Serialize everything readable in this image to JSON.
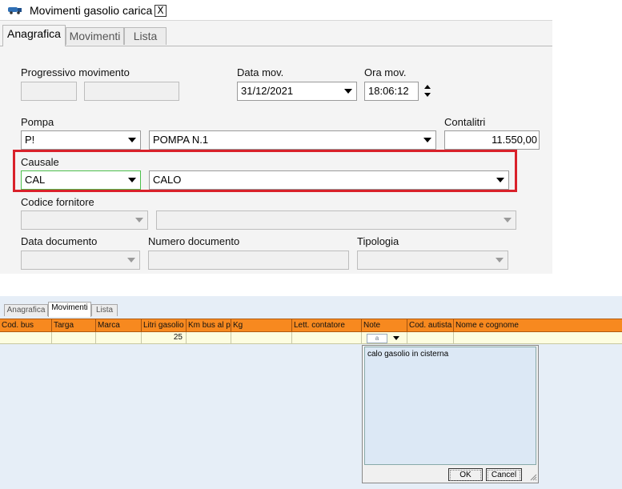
{
  "window": {
    "title": "Movimenti gasolio carica",
    "close_label": "X",
    "tabs": [
      "Anagrafica",
      "Movimenti",
      "Lista"
    ],
    "active_tab": "Anagrafica"
  },
  "form": {
    "progressivo": {
      "label": "Progressivo movimento",
      "value1": "",
      "value2": ""
    },
    "data_mov": {
      "label": "Data mov.",
      "value": "31/12/2021"
    },
    "ora_mov": {
      "label": "Ora mov.",
      "value": "18:06:12"
    },
    "pompa": {
      "label": "Pompa",
      "code": "P!",
      "description": "POMPA N.1"
    },
    "contalitri": {
      "label": "Contalitri",
      "value": "11.550,00"
    },
    "causale": {
      "label": "Causale",
      "code": "CAL",
      "description": "CALO"
    },
    "codice_fornitore": {
      "label": "Codice fornitore",
      "code": "",
      "description": ""
    },
    "data_documento": {
      "label": "Data documento",
      "value": ""
    },
    "numero_documento": {
      "label": "Numero documento",
      "value": ""
    },
    "tipologia": {
      "label": "Tipologia",
      "value": ""
    }
  },
  "highlight_color": "#d9212a",
  "grid_header_color": "#f7891f",
  "bottom": {
    "tabs": [
      "Anagrafica",
      "Movimenti",
      "Lista"
    ],
    "active_tab": "Movimenti",
    "columns": [
      "Cod. bus",
      "Targa",
      "Marca",
      "Litri gasolio",
      "Km bus al pr",
      "Kg",
      "Lett. contatore",
      "Note",
      "Cod. autista",
      "Nome e cognome"
    ],
    "row": {
      "cod_bus": "",
      "targa": "",
      "marca": "",
      "litri_gasolio": "25",
      "km_bus": "",
      "kg": "",
      "lett_contatore": "",
      "note": "a",
      "cod_autista": "",
      "nome_cognome": ""
    },
    "memo": {
      "text": "calo gasolio in cisterna",
      "ok_label": "OK",
      "cancel_label": "Cancel"
    }
  }
}
